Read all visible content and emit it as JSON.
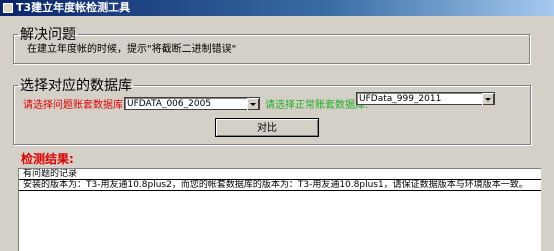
{
  "window": {
    "title": "T3建立年度帐检测工具"
  },
  "section1": {
    "legend": "解决问题",
    "hint": "在建立年度帐的时候，提示\"将截断二进制错误\""
  },
  "section2": {
    "legend": "选择对应的数据库",
    "problem_label": "请选择问题账套数据库:",
    "problem_value": "UFDATA_006_2005",
    "normal_label": "请选择正常账套数据库:",
    "normal_value": "UFData_999_2011",
    "compare_button": "对比"
  },
  "results": {
    "title": "检测结果:",
    "rows": [
      "有问题的记录",
      "安装的版本为：T3-用友通10.8plus2，而您的帐套数据库的版本为：T3-用友通10.8plus1，请保证数据版本与环境版本一致。"
    ]
  }
}
